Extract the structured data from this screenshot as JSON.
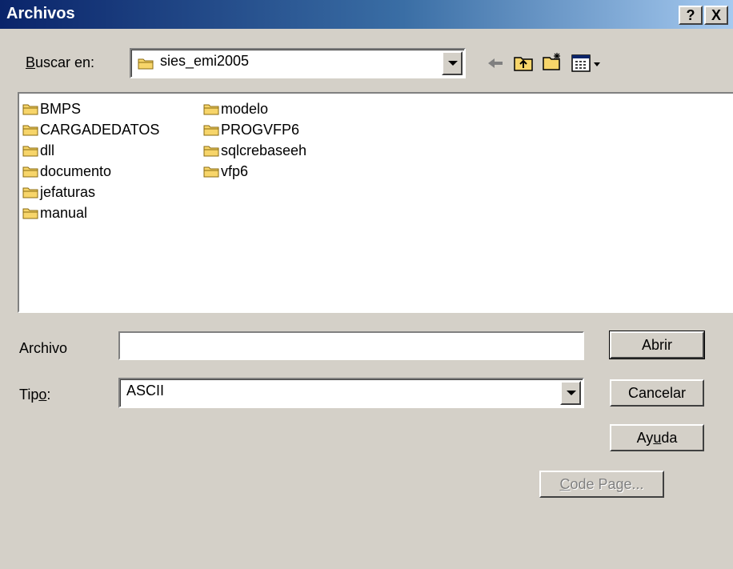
{
  "window": {
    "title": "Archivos",
    "help_button": "?",
    "close_button": "X"
  },
  "look_in": {
    "label_accel": "B",
    "label_rest": "uscar en:",
    "value": "sies_emi2005"
  },
  "toolbar": {
    "icons": [
      "back-arrow-icon",
      "up-folder-icon",
      "new-folder-icon",
      "view-menu-icon"
    ]
  },
  "file_list": {
    "column1": [
      "BMPS",
      "CARGADEDATOS",
      "dll",
      "documento",
      "jefaturas",
      "manual"
    ],
    "column2": [
      "modelo",
      "PROGVFP6",
      "sqlcrebaseeh",
      "vfp6"
    ]
  },
  "file_name": {
    "label": "Archivo",
    "value": ""
  },
  "file_type": {
    "label_pre": "Tip",
    "label_accel": "o",
    "label_post": ":",
    "value": "ASCII"
  },
  "buttons": {
    "open": "Abrir",
    "cancel": "Cancelar",
    "help_pre": "Ay",
    "help_accel": "u",
    "help_post": "da",
    "code_page_accel": "C",
    "code_page_rest": "ode Page..."
  },
  "colors": {
    "title_start": "#0a246a",
    "title_end": "#a6caf0",
    "face": "#d4d0c8",
    "folder": "#f7d56a"
  }
}
